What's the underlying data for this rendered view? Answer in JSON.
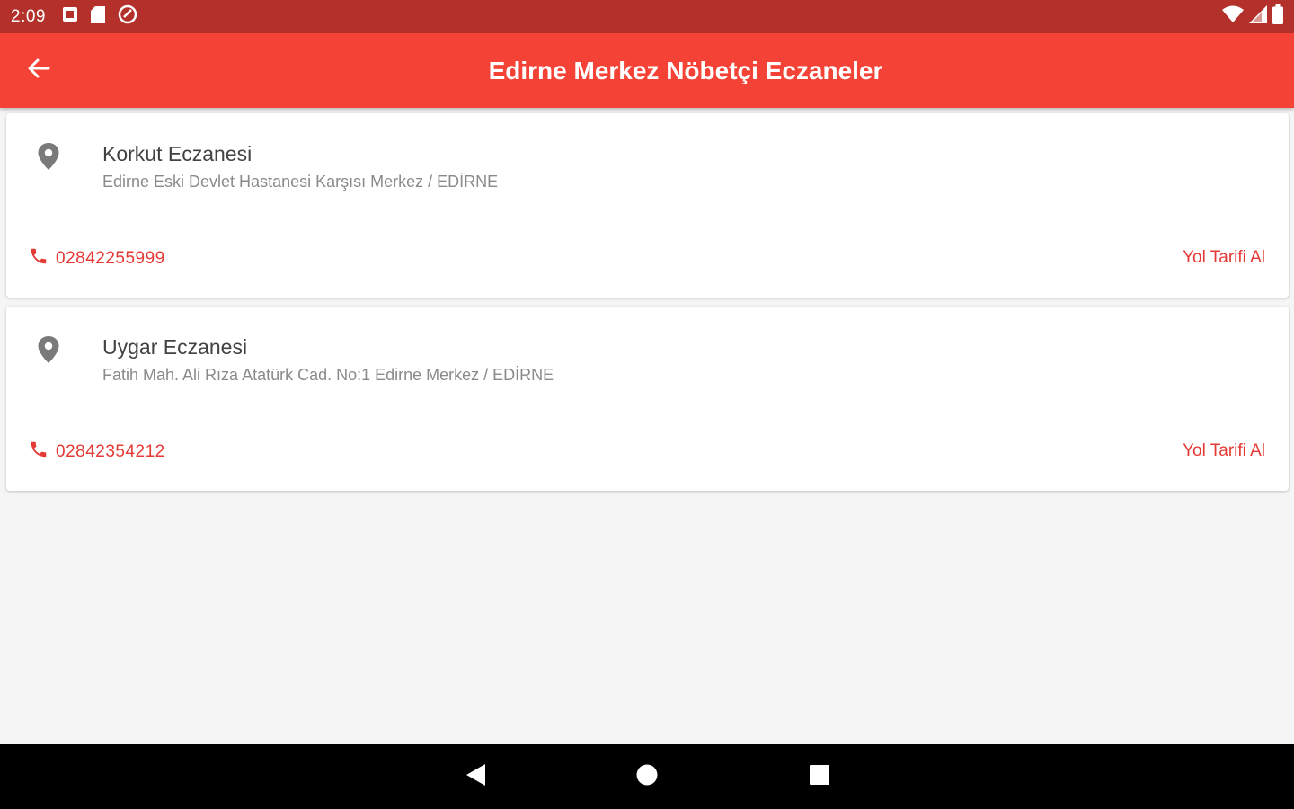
{
  "status_bar": {
    "time": "2:09",
    "left_icons": [
      "notification-icon",
      "sd-card-icon",
      "sync-icon"
    ],
    "right_icons": [
      "wifi-icon",
      "cell-signal-icon",
      "battery-icon"
    ]
  },
  "app_bar": {
    "title": "Edirne Merkez Nöbetçi Eczaneler",
    "back_icon": "arrow-back-icon"
  },
  "colors": {
    "status_bar": "#b3312a",
    "app_bar": "#f44336",
    "accent": "#e53935",
    "background": "#f5f5f5"
  },
  "pharmacies": [
    {
      "name": "Korkut Eczanesi",
      "address": "Edirne Eski Devlet Hastanesi Karşısı Merkez / EDİRNE",
      "phone": "02842255999",
      "directions_label": "Yol Tarifi Al"
    },
    {
      "name": "Uygar Eczanesi",
      "address": "Fatih Mah. Ali Rıza Atatürk Cad. No:1 Edirne Merkez / EDİRNE",
      "phone": "02842354212",
      "directions_label": "Yol Tarifi Al"
    }
  ],
  "nav_bar": {
    "buttons": [
      "back-triangle-icon",
      "home-circle-icon",
      "recents-square-icon"
    ]
  }
}
